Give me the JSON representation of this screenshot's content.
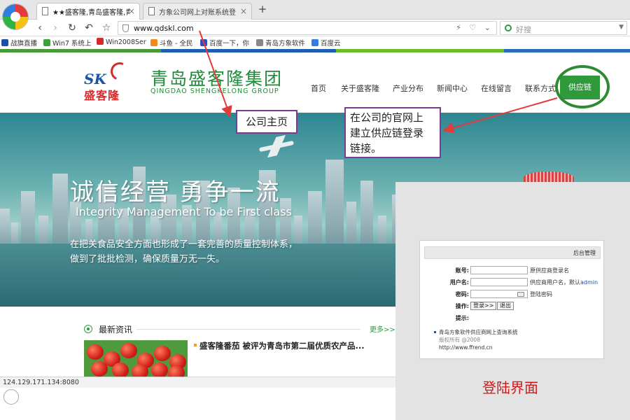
{
  "browser": {
    "tabs": [
      {
        "label": "★★盛客隆,青岛盛客隆,青岛",
        "active": true
      },
      {
        "label": "方象公司网上对账系统登录",
        "active": false
      }
    ],
    "new_tab": "+",
    "close": "×",
    "nav": {
      "back": "‹",
      "forward": "›",
      "reload": "↻",
      "undo": "↶",
      "star": "☆"
    },
    "url": "www.qdskl.com",
    "url_tools": "⚡ ♡ ⌄",
    "search_placeholder": "好搜",
    "search_drop": "▼",
    "bookmarks": [
      {
        "label": "战旗直播",
        "color": "#1a4ea8"
      },
      {
        "label": "Win7 系统上",
        "color": "#3aa335"
      },
      {
        "label": "Win2008Ser",
        "color": "#d22b2b"
      },
      {
        "label": "斗鱼 - 全民",
        "color": "#f08a1c"
      },
      {
        "label": "百度一下，你",
        "color": "#2f4ec2"
      },
      {
        "label": "青岛方象软件",
        "color": "#888888"
      },
      {
        "label": "百度云",
        "color": "#2f7de1"
      }
    ],
    "status_url": "124.129.171.134:8080"
  },
  "site": {
    "logo_sk": "SK",
    "logo_cn": "盛客隆",
    "brand_cn": "青岛盛客隆集团",
    "brand_en": "QINGDAO SHENGKELONG GROUP",
    "menu": [
      "首页",
      "关于盛客隆",
      "产业分布",
      "新闻中心",
      "在线留言",
      "联系方式"
    ],
    "supply_chain": "供应链",
    "banner": {
      "slogan_cn": "诚信经营 勇争一流",
      "slogan_en": "Integrity Management To be First class",
      "desc_line1": "在把关食品安全方面也形成了一套完善的质量控制体系，",
      "desc_line2": "做到了批批检测，确保质量万无一失。"
    },
    "news": {
      "title": "最新资讯",
      "more": "更多>>",
      "item": "盛客隆番茄 被评为青岛市第二届优质农产品..."
    }
  },
  "annotations": {
    "home": "公司主页",
    "supply_line1": "在公司的官网上",
    "supply_line2": "建立供应链登录",
    "supply_line3": "链接。",
    "login_caption": "登陆界面",
    "arrow_color": "#e23b3b",
    "box_color": "#7a3b96",
    "ring_color": "#2e8a34"
  },
  "login": {
    "header": "后台管理",
    "rows": [
      {
        "label": "账号:",
        "hint": "原供应商登录名"
      },
      {
        "label": "用户名:",
        "hint": "供应商用户名，默认",
        "hint_extra": "admin"
      },
      {
        "label": "密码:",
        "hint": "登陆密码"
      }
    ],
    "action_label": "操作:",
    "login_btn": "登录>>",
    "exit_btn": "退出",
    "tip_label": "提示:",
    "footer_name": "青岛方象软件供应商网上查询系统",
    "footer_copy": "版权所有 @2008",
    "footer_site": "http://www.ffrend.cn"
  }
}
